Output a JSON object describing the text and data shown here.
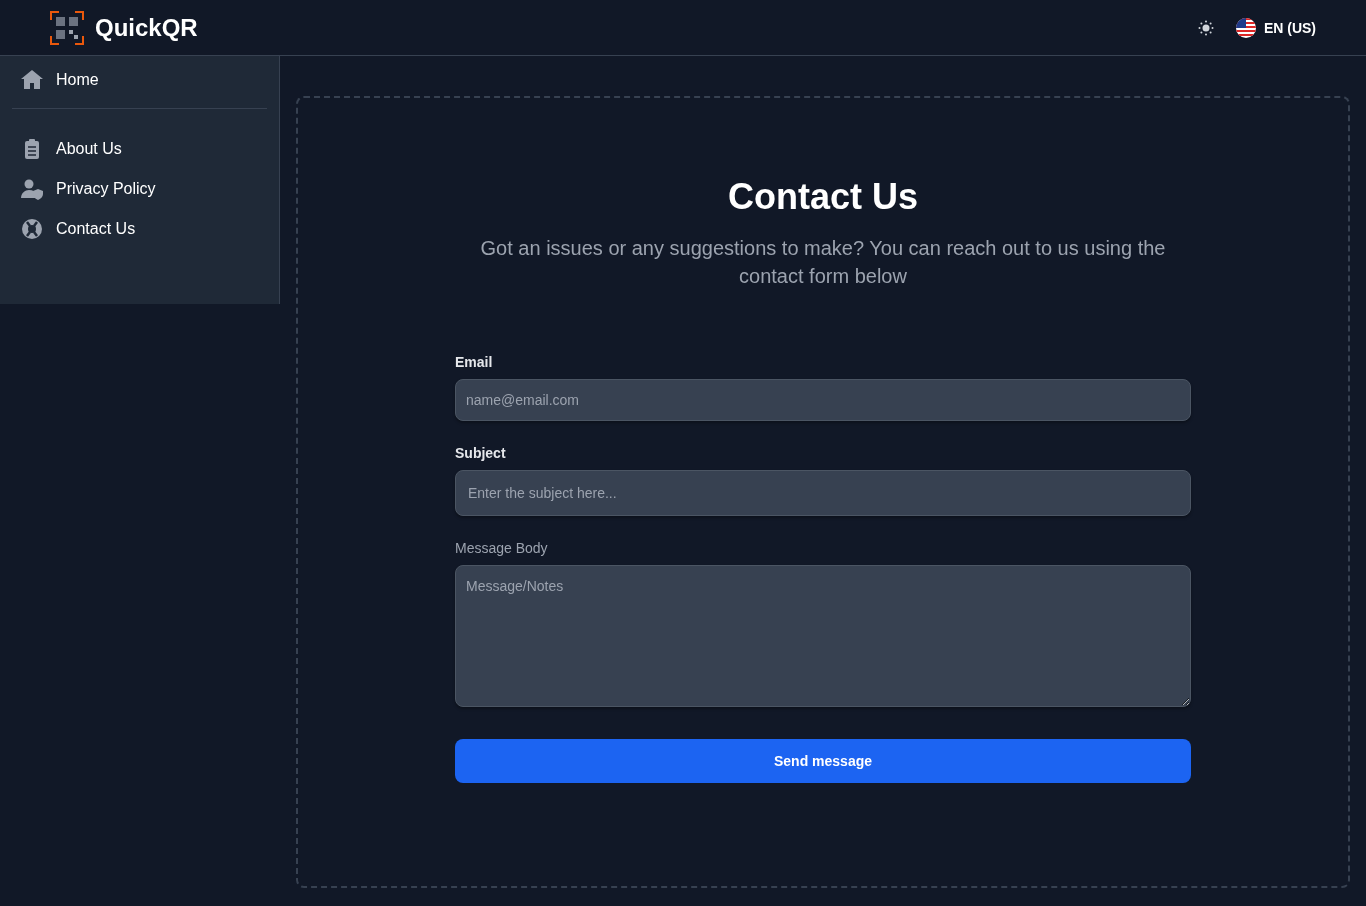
{
  "header": {
    "brand": "QuickQR",
    "language": "EN (US)"
  },
  "sidebar": {
    "items": [
      {
        "label": "Home",
        "kind": "home"
      },
      {
        "label": "About Us",
        "kind": "clipboard"
      },
      {
        "label": "Privacy Policy",
        "kind": "user-shield"
      },
      {
        "label": "Contact Us",
        "kind": "lifebuoy"
      }
    ]
  },
  "content": {
    "title": "Contact Us",
    "subtitle": "Got an issues or any suggestions to make? You can reach out to us using the contact form below",
    "fields": [
      {
        "label": "Email",
        "placeholder": "name@email.com",
        "kind": "input"
      },
      {
        "label": "Subject",
        "placeholder": "Enter the subject here...",
        "kind": "input"
      },
      {
        "label": "Message Body",
        "placeholder": "Message/Notes",
        "kind": "textarea"
      }
    ],
    "button": "Send message"
  }
}
